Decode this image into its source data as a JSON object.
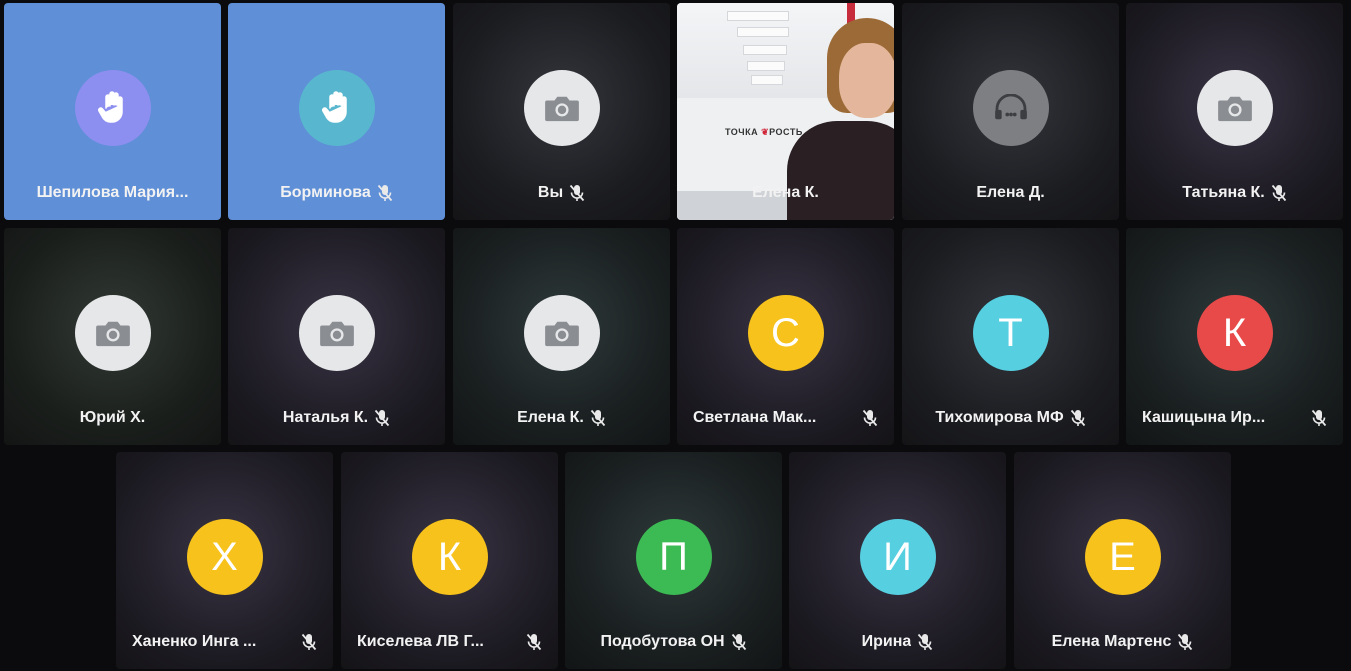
{
  "colors": {
    "background": "#0b0b0d",
    "hand_raised_tile": "#5f8fd6",
    "avatar_yellow": "#f6c21b",
    "avatar_cyan": "#56cfe1",
    "avatar_red": "#e84a4a",
    "avatar_green": "#3cba54"
  },
  "participants": [
    {
      "name": "Шепилова Мария...",
      "muted": false,
      "avatar": "hand-raised-icon"
    },
    {
      "name": "Борминова",
      "muted": true,
      "avatar": "hand-raised-icon"
    },
    {
      "name": "Вы",
      "muted": true,
      "avatar": "camera-off-icon"
    },
    {
      "name": "Елена К.",
      "muted": false,
      "avatar": "video"
    },
    {
      "name": "Елена Д.",
      "muted": false,
      "avatar": "headphones-icon"
    },
    {
      "name": "Татьяна К.",
      "muted": true,
      "avatar": "camera-off-icon"
    },
    {
      "name": "Юрий Х.",
      "muted": false,
      "avatar": "camera-off-icon"
    },
    {
      "name": "Наталья К.",
      "muted": true,
      "avatar": "camera-off-icon"
    },
    {
      "name": "Елена К.",
      "muted": true,
      "avatar": "camera-off-icon"
    },
    {
      "name": "Светлана Мак...",
      "muted": true,
      "avatar": "letter",
      "letter": "С",
      "color": "#f6c21b"
    },
    {
      "name": "Тихомирова МФ",
      "muted": true,
      "avatar": "letter",
      "letter": "Т",
      "color": "#56cfe1"
    },
    {
      "name": "Кашицына Ир...",
      "muted": true,
      "avatar": "letter",
      "letter": "К",
      "color": "#e84a4a"
    },
    {
      "name": "Ханенко Инга ...",
      "muted": true,
      "avatar": "letter",
      "letter": "Х",
      "color": "#f6c21b"
    },
    {
      "name": "Киселева ЛВ Г...",
      "muted": true,
      "avatar": "letter",
      "letter": "К",
      "color": "#f6c21b"
    },
    {
      "name": "Подобутова ОН",
      "muted": true,
      "avatar": "letter",
      "letter": "П",
      "color": "#3cba54"
    },
    {
      "name": "Ирина",
      "muted": true,
      "avatar": "letter",
      "letter": "И",
      "color": "#56cfe1"
    },
    {
      "name": "Елена Мартенс",
      "muted": true,
      "avatar": "letter",
      "letter": "Е",
      "color": "#f6c21b"
    }
  ],
  "video_overlay": {
    "logo_text_1": "ТОЧКА",
    "logo_text_2": "РОСТЬ"
  }
}
